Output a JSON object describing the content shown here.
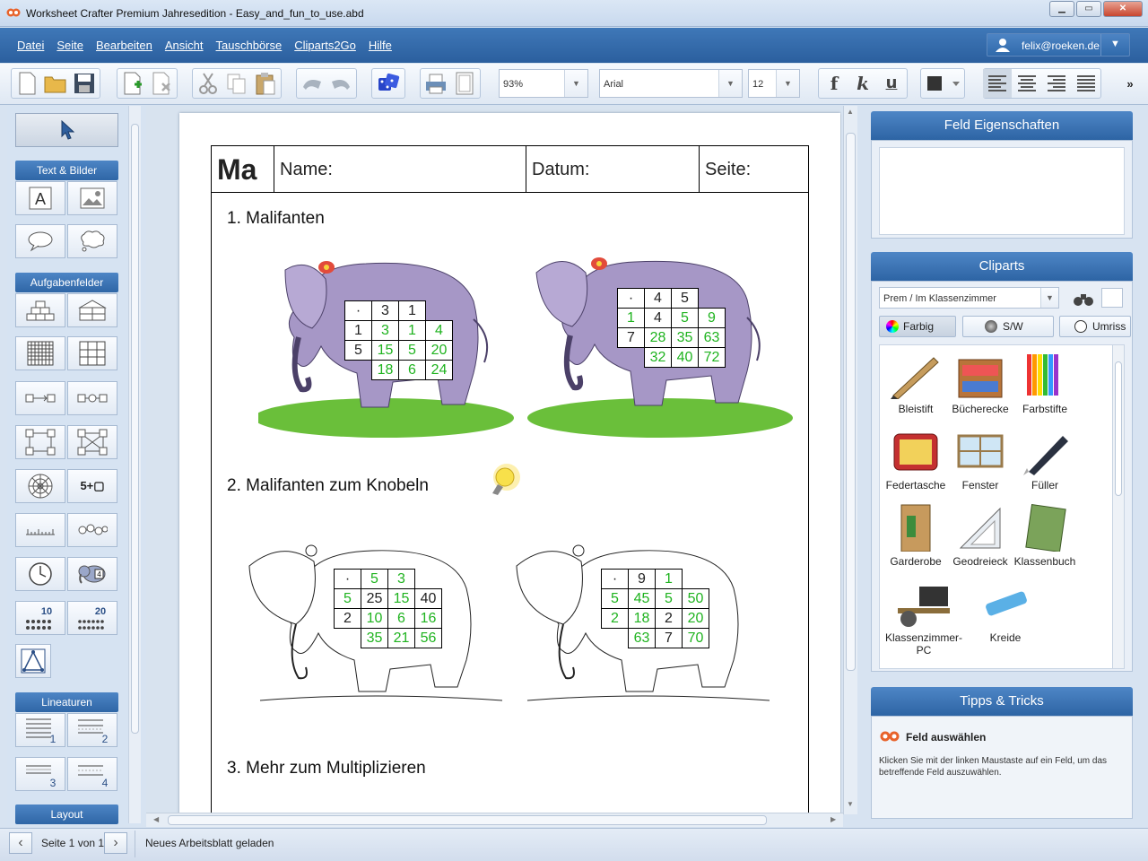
{
  "window": {
    "title": "Worksheet Crafter Premium Jahresedition - Easy_and_fun_to_use.abd"
  },
  "menu": [
    "Datei",
    "Seite",
    "Bearbeiten",
    "Ansicht",
    "Tauschbörse",
    "Cliparts2Go",
    "Hilfe"
  ],
  "user": {
    "email": "felix@roeken.de"
  },
  "toolbar": {
    "zoom": "93%",
    "font": "Arial",
    "size": "12",
    "bold": "f",
    "italic": "k",
    "underline": "u"
  },
  "left_panel": {
    "sections": {
      "text_images": "Text & Bilder",
      "task_fields": "Aufgabenfelder",
      "ruling": "Lineaturen",
      "layout": "Layout"
    },
    "ten_label": "10",
    "twenty_label": "20",
    "five_plus": "5+▢",
    "line1": "1",
    "line2": "2",
    "line3": "3",
    "line4": "4",
    "elephant_num": "4"
  },
  "worksheet": {
    "header": {
      "subject": "Ma",
      "name": "Name:",
      "date": "Datum:",
      "page": "Seite:"
    },
    "tasks": [
      "1. Malifanten",
      "2. Malifanten zum Knobeln",
      "3. Mehr zum Multiplizieren"
    ],
    "grids": [
      {
        "rows": [
          [
            [
              "·",
              "b"
            ],
            [
              "3",
              "b"
            ],
            [
              "1",
              "b"
            ],
            [
              "",
              ""
            ]
          ],
          [
            [
              "1",
              "b"
            ],
            [
              "3",
              "g"
            ],
            [
              "1",
              "g"
            ],
            [
              "4",
              "g"
            ]
          ],
          [
            [
              "5",
              "b"
            ],
            [
              "15",
              "g"
            ],
            [
              "5",
              "g"
            ],
            [
              "20",
              "g"
            ]
          ],
          [
            [
              "",
              "e"
            ],
            [
              "18",
              "g"
            ],
            [
              "6",
              "g"
            ],
            [
              "24",
              "g"
            ]
          ]
        ]
      },
      {
        "rows": [
          [
            [
              "·",
              "b"
            ],
            [
              "4",
              "b"
            ],
            [
              "5",
              "b"
            ],
            [
              "",
              ""
            ]
          ],
          [
            [
              "1",
              "g"
            ],
            [
              "4",
              "b"
            ],
            [
              "5",
              "g"
            ],
            [
              "9",
              "g"
            ]
          ],
          [
            [
              "7",
              "b"
            ],
            [
              "28",
              "g"
            ],
            [
              "35",
              "g"
            ],
            [
              "63",
              "g"
            ]
          ],
          [
            [
              "",
              "e"
            ],
            [
              "32",
              "g"
            ],
            [
              "40",
              "g"
            ],
            [
              "72",
              "g"
            ]
          ]
        ]
      },
      {
        "rows": [
          [
            [
              "·",
              "b"
            ],
            [
              "5",
              "g"
            ],
            [
              "3",
              "g"
            ],
            [
              "",
              ""
            ]
          ],
          [
            [
              "5",
              "g"
            ],
            [
              "25",
              "b"
            ],
            [
              "15",
              "g"
            ],
            [
              "40",
              "b"
            ]
          ],
          [
            [
              "2",
              "b"
            ],
            [
              "10",
              "g"
            ],
            [
              "6",
              "g"
            ],
            [
              "16",
              "g"
            ]
          ],
          [
            [
              "",
              "e"
            ],
            [
              "35",
              "g"
            ],
            [
              "21",
              "g"
            ],
            [
              "56",
              "g"
            ]
          ]
        ]
      },
      {
        "rows": [
          [
            [
              "·",
              "b"
            ],
            [
              "9",
              "b"
            ],
            [
              "1",
              "g"
            ],
            [
              "",
              ""
            ]
          ],
          [
            [
              "5",
              "g"
            ],
            [
              "45",
              "g"
            ],
            [
              "5",
              "g"
            ],
            [
              "50",
              "g"
            ]
          ],
          [
            [
              "2",
              "g"
            ],
            [
              "18",
              "g"
            ],
            [
              "2",
              "b"
            ],
            [
              "20",
              "g"
            ]
          ],
          [
            [
              "",
              "e"
            ],
            [
              "63",
              "g"
            ],
            [
              "7",
              "b"
            ],
            [
              "70",
              "g"
            ]
          ]
        ]
      }
    ]
  },
  "right_panel": {
    "field_props_title": "Feld Eigenschaften",
    "cliparts_title": "Cliparts",
    "category": "Prem / Im Klassenzimmer",
    "modes": [
      "Farbig",
      "S/W",
      "Umriss"
    ],
    "items": [
      "Bleistift",
      "Bücherecke",
      "Farbstifte",
      "Federtasche",
      "Fenster",
      "Füller",
      "Garderobe",
      "Geodreieck",
      "Klassenbuch",
      "Klassenzimmer-PC",
      "Kreide"
    ],
    "tips_title": "Tipps & Tricks",
    "tip_heading": "Feld auswählen",
    "tip_text": "Klicken Sie mit der linken Maustaste auf ein Feld, um das betreffende Feld auszuwählen."
  },
  "status": {
    "page": "Seite 1 von 1",
    "message": "Neues Arbeitsblatt geladen"
  },
  "colors": {
    "accent": "#2f66a6",
    "green_digits": "#1fb31f"
  }
}
